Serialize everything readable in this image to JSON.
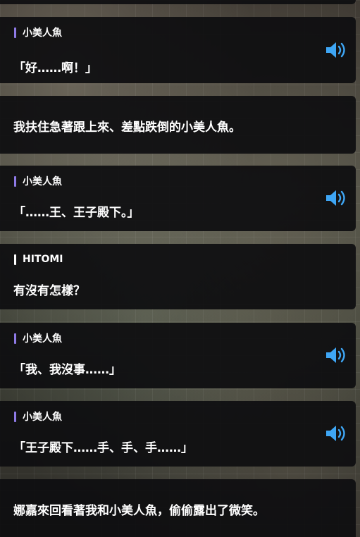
{
  "log": {
    "entries": [
      {
        "speaker": "小美人魚",
        "text": "「好……啊！」",
        "voice": true,
        "voice_icon": "speaker-icon"
      },
      {
        "speaker": "",
        "text": "我扶住急著跟上來、差點跌倒的小美人魚。",
        "voice": false
      },
      {
        "speaker": "小美人魚",
        "text": "「……王、王子殿下。」",
        "voice": true,
        "voice_icon": "speaker-icon"
      },
      {
        "speaker": "HITOMI",
        "text": "有沒有怎樣？",
        "voice": false
      },
      {
        "speaker": "小美人魚",
        "text": "「我、我沒事……」",
        "voice": true,
        "voice_icon": "speaker-icon"
      },
      {
        "speaker": "小美人魚",
        "text": "「王子殿下……手、手、手……」",
        "voice": true,
        "voice_icon": "speaker-icon"
      },
      {
        "speaker": "",
        "text": "娜嘉來回看著我和小美人魚，偷偷露出了微笑。",
        "voice": false
      }
    ]
  },
  "colors": {
    "speaker_bar_character": "#8e7ae6",
    "speaker_bar_player": "#ffffff",
    "voice_icon": "#3ea6f5",
    "panel": "#0e0e10"
  }
}
